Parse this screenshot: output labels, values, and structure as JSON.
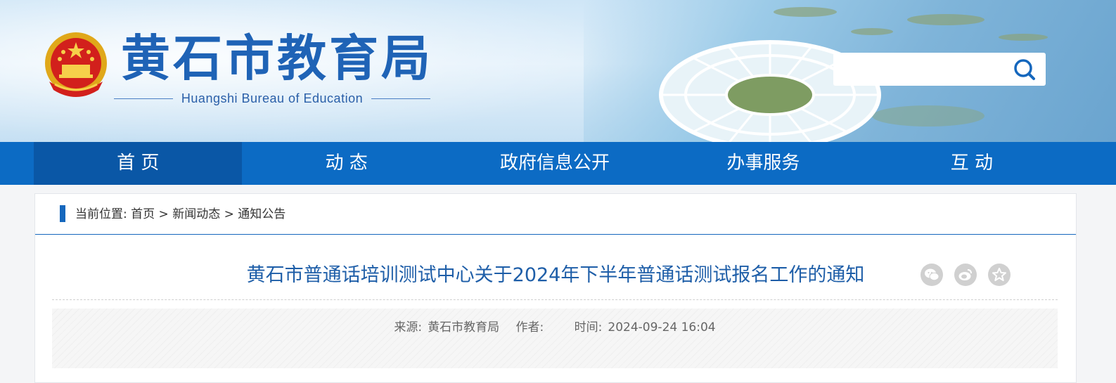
{
  "header": {
    "title_cn": "黄石市教育局",
    "title_en": "Huangshi Bureau of Education",
    "emblem_icon": "national-emblem-icon",
    "search": {
      "value": "",
      "placeholder": "",
      "icon": "search-icon"
    }
  },
  "nav": {
    "items": [
      {
        "label": "首 页",
        "active": true
      },
      {
        "label": "动 态",
        "active": false
      },
      {
        "label": "政府信息公开",
        "active": false
      },
      {
        "label": "办事服务",
        "active": false
      },
      {
        "label": "互 动",
        "active": false
      }
    ]
  },
  "breadcrumb": {
    "prefix": "当前位置:",
    "items": [
      "首页",
      "新闻动态",
      "通知公告"
    ],
    "separator": ">"
  },
  "article": {
    "title": "黄石市普通话培训测试中心关于2024年下半年普通话测试报名工作的通知",
    "source_label": "来源:",
    "source_value": "黄石市教育局",
    "author_label": "作者:",
    "author_value": "",
    "time_label": "时间:",
    "time_value": "2024-09-24 16:04"
  },
  "share": [
    "wechat-icon",
    "weibo-icon",
    "favorite-icon"
  ],
  "colors": {
    "brand_blue": "#0c6bc4",
    "nav_active": "#0a57a6",
    "title_blue": "#1e5ea8"
  }
}
